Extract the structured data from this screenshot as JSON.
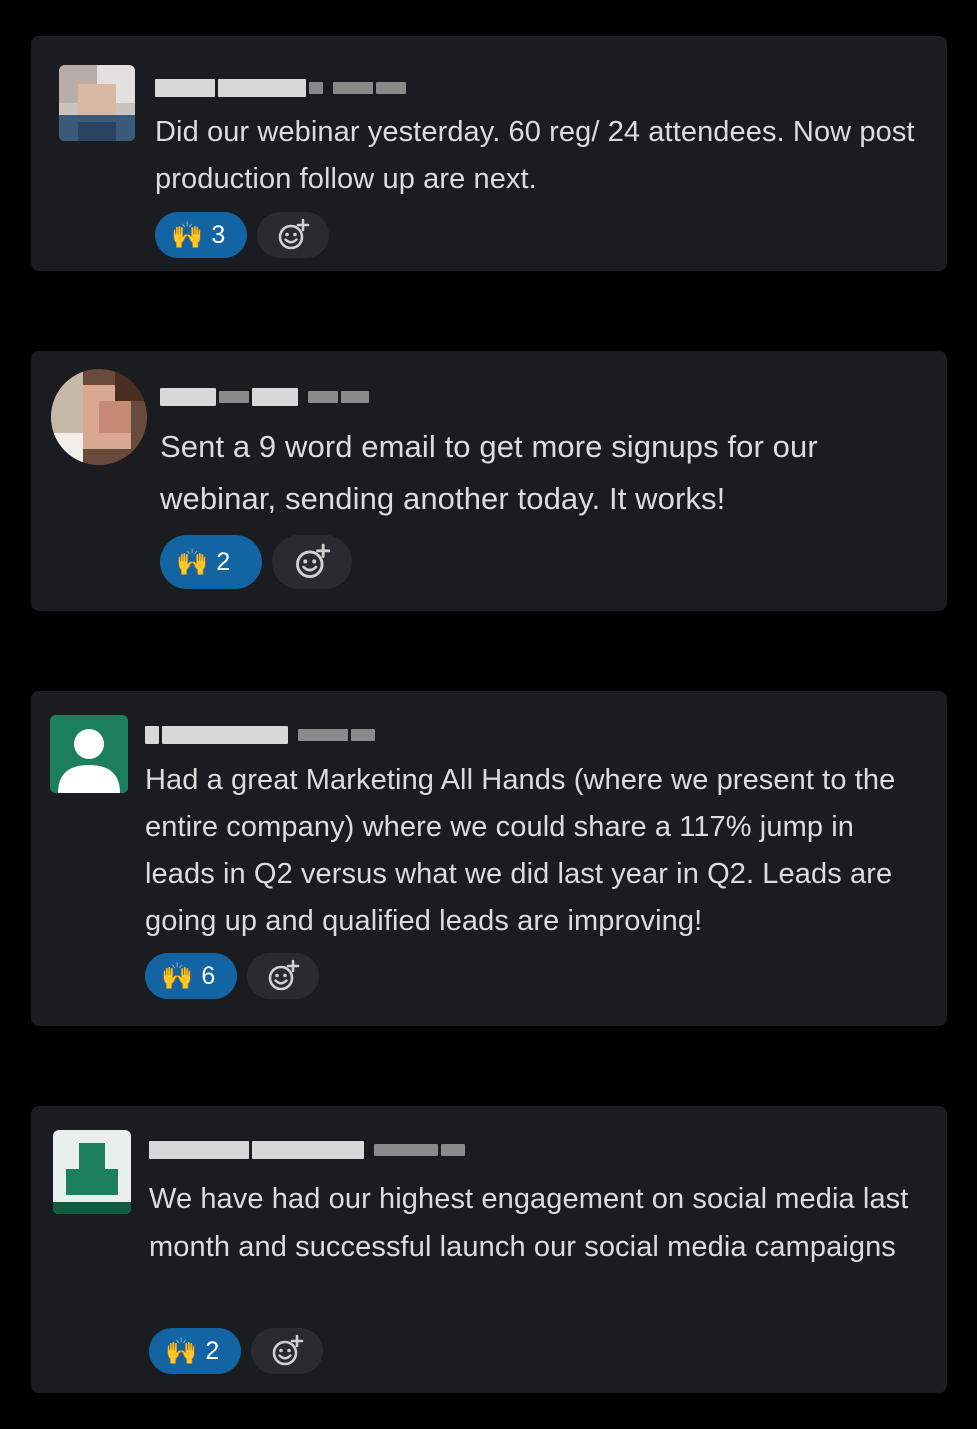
{
  "messages": [
    {
      "text": "Did our webinar yesterday. 60 reg/ 24 attendees. Now post production follow up are next.",
      "reaction": {
        "emoji": "🙌",
        "count": "3"
      }
    },
    {
      "text": "Sent a 9 word email to get more signups for our webinar, sending another today. It works!",
      "reaction": {
        "emoji": "🙌",
        "count": "2"
      }
    },
    {
      "text": "Had a great Marketing All Hands (where we present to the entire company) where we could share a 117% jump in leads in Q2 versus what we did last year in Q2. Leads are going up and qualified leads are improving!",
      "reaction": {
        "emoji": "🙌",
        "count": "6"
      }
    },
    {
      "text": "We have had our highest engagement on social media last month and successful launch our social media campaigns",
      "reaction": {
        "emoji": "🙌",
        "count": "2"
      }
    }
  ],
  "colors": {
    "background": "#000000",
    "card": "#1b1c1f",
    "reaction_pill": "#1264a3",
    "add_reaction": "#2a2b2e",
    "avatar_green": "#1a7f5a"
  },
  "icons": {
    "reaction": "raised-hands-emoji",
    "add_reaction": "add-reaction-icon"
  }
}
